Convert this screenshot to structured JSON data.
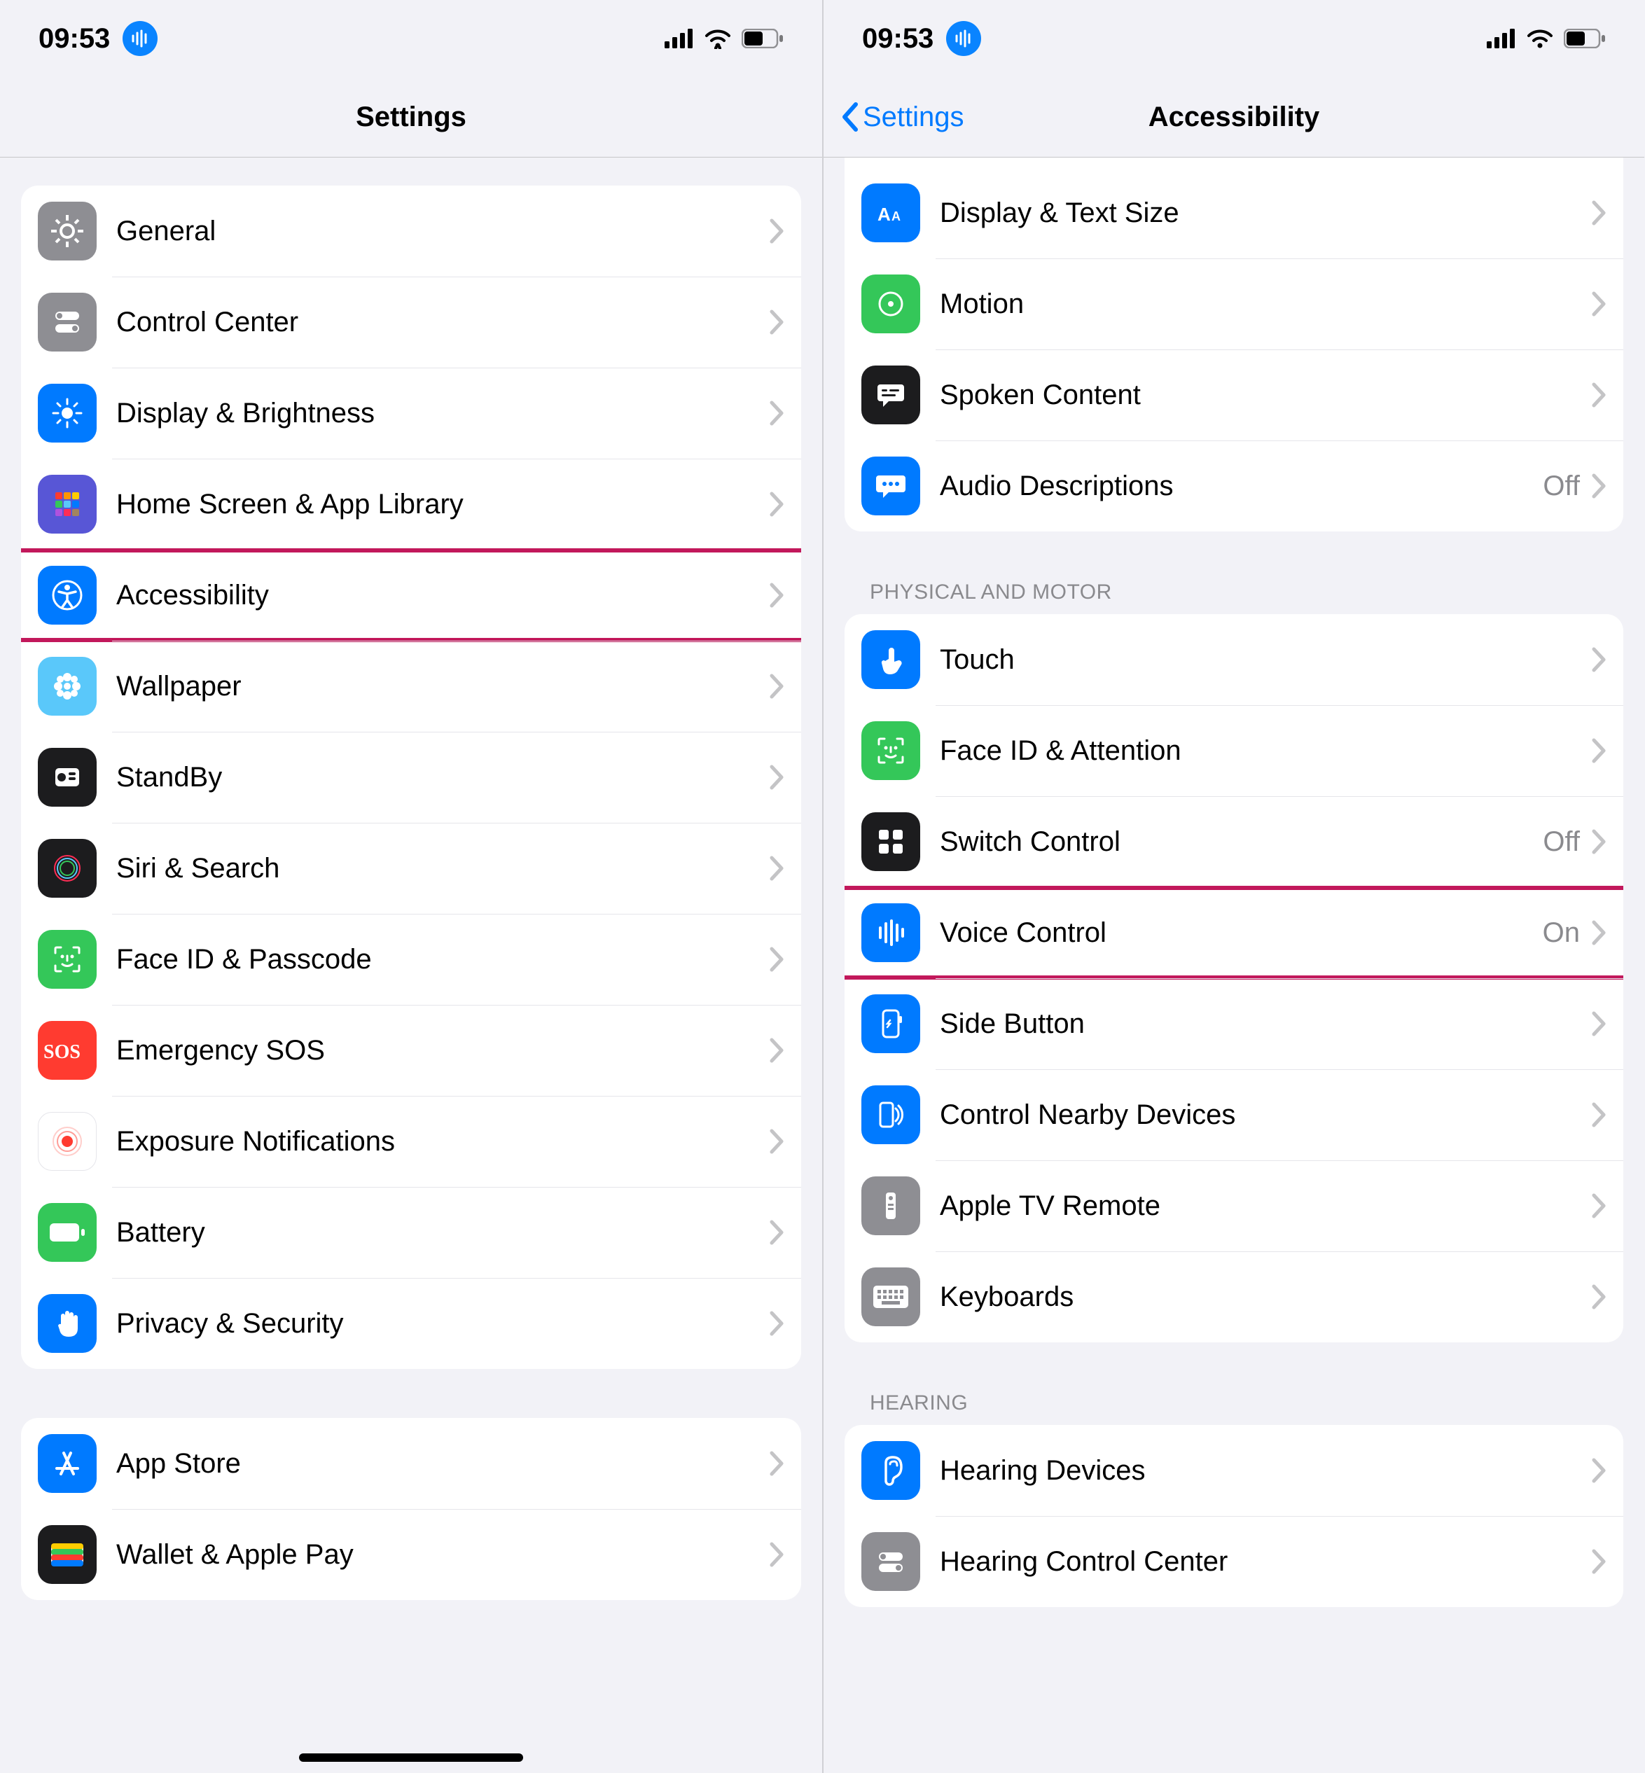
{
  "status": {
    "time": "09:53"
  },
  "left": {
    "title": "Settings",
    "groups": [
      {
        "items": [
          {
            "id": "general",
            "label": "General",
            "icon": "gear-icon",
            "bg": "bg-gray"
          },
          {
            "id": "control-center",
            "label": "Control Center",
            "icon": "switches-icon",
            "bg": "bg-gray"
          },
          {
            "id": "display-brightness",
            "label": "Display & Brightness",
            "icon": "sun-icon",
            "bg": "bg-blue"
          },
          {
            "id": "home-screen",
            "label": "Home Screen & App Library",
            "icon": "grid-icon",
            "bg": "bg-purple-grid"
          },
          {
            "id": "accessibility",
            "label": "Accessibility",
            "icon": "accessibility-icon",
            "bg": "bg-blue",
            "hl": true
          },
          {
            "id": "wallpaper",
            "label": "Wallpaper",
            "icon": "flower-icon",
            "bg": "bg-lblue"
          },
          {
            "id": "standby",
            "label": "StandBy",
            "icon": "standby-icon",
            "bg": "bg-black"
          },
          {
            "id": "siri-search",
            "label": "Siri & Search",
            "icon": "siri-icon",
            "bg": "bg-black"
          },
          {
            "id": "faceid-passcode",
            "label": "Face ID & Passcode",
            "icon": "faceid-icon",
            "bg": "bg-green"
          },
          {
            "id": "emergency-sos",
            "label": "Emergency SOS",
            "icon": "sos-icon",
            "bg": "bg-red"
          },
          {
            "id": "exposure",
            "label": "Exposure Notifications",
            "icon": "exposure-icon",
            "bg": "bg-white"
          },
          {
            "id": "battery",
            "label": "Battery",
            "icon": "battery-icon",
            "bg": "bg-green"
          },
          {
            "id": "privacy-security",
            "label": "Privacy & Security",
            "icon": "hand-icon",
            "bg": "bg-blue"
          }
        ]
      },
      {
        "items": [
          {
            "id": "app-store",
            "label": "App Store",
            "icon": "appstore-icon",
            "bg": "bg-blue"
          },
          {
            "id": "wallet",
            "label": "Wallet & Apple Pay",
            "icon": "wallet-icon",
            "bg": "bg-black"
          }
        ]
      }
    ]
  },
  "right": {
    "back": "Settings",
    "title": "Accessibility",
    "partial_top": [
      {
        "id": "display-text-size",
        "label": "Display & Text Size",
        "icon": "text-size-icon",
        "bg": "bg-blue"
      },
      {
        "id": "motion",
        "label": "Motion",
        "icon": "motion-icon",
        "bg": "bg-green"
      },
      {
        "id": "spoken-content",
        "label": "Spoken Content",
        "icon": "speech-bubble-icon",
        "bg": "bg-black"
      },
      {
        "id": "audio-descriptions",
        "label": "Audio Descriptions",
        "icon": "ad-bubble-icon",
        "bg": "bg-blue",
        "detail": "Off"
      }
    ],
    "sections": [
      {
        "header": "PHYSICAL AND MOTOR",
        "items": [
          {
            "id": "touch",
            "label": "Touch",
            "icon": "touch-icon",
            "bg": "bg-blue"
          },
          {
            "id": "faceid-attention",
            "label": "Face ID & Attention",
            "icon": "faceid-icon",
            "bg": "bg-green"
          },
          {
            "id": "switch-control",
            "label": "Switch Control",
            "icon": "switch-control-icon",
            "bg": "bg-black",
            "detail": "Off"
          },
          {
            "id": "voice-control",
            "label": "Voice Control",
            "icon": "voice-control-icon",
            "bg": "bg-blue",
            "detail": "On",
            "hl": true
          },
          {
            "id": "side-button",
            "label": "Side Button",
            "icon": "side-button-icon",
            "bg": "bg-blue"
          },
          {
            "id": "control-nearby",
            "label": "Control Nearby Devices",
            "icon": "nearby-icon",
            "bg": "bg-blue"
          },
          {
            "id": "apple-tv-remote",
            "label": "Apple TV Remote",
            "icon": "remote-icon",
            "bg": "bg-gray"
          },
          {
            "id": "keyboards",
            "label": "Keyboards",
            "icon": "keyboard-icon",
            "bg": "bg-gray"
          }
        ]
      },
      {
        "header": "HEARING",
        "items": [
          {
            "id": "hearing-devices",
            "label": "Hearing Devices",
            "icon": "ear-icon",
            "bg": "bg-blue"
          },
          {
            "id": "hearing-control-center",
            "label": "Hearing Control Center",
            "icon": "hearing-cc-icon",
            "bg": "bg-gray"
          }
        ]
      }
    ]
  }
}
